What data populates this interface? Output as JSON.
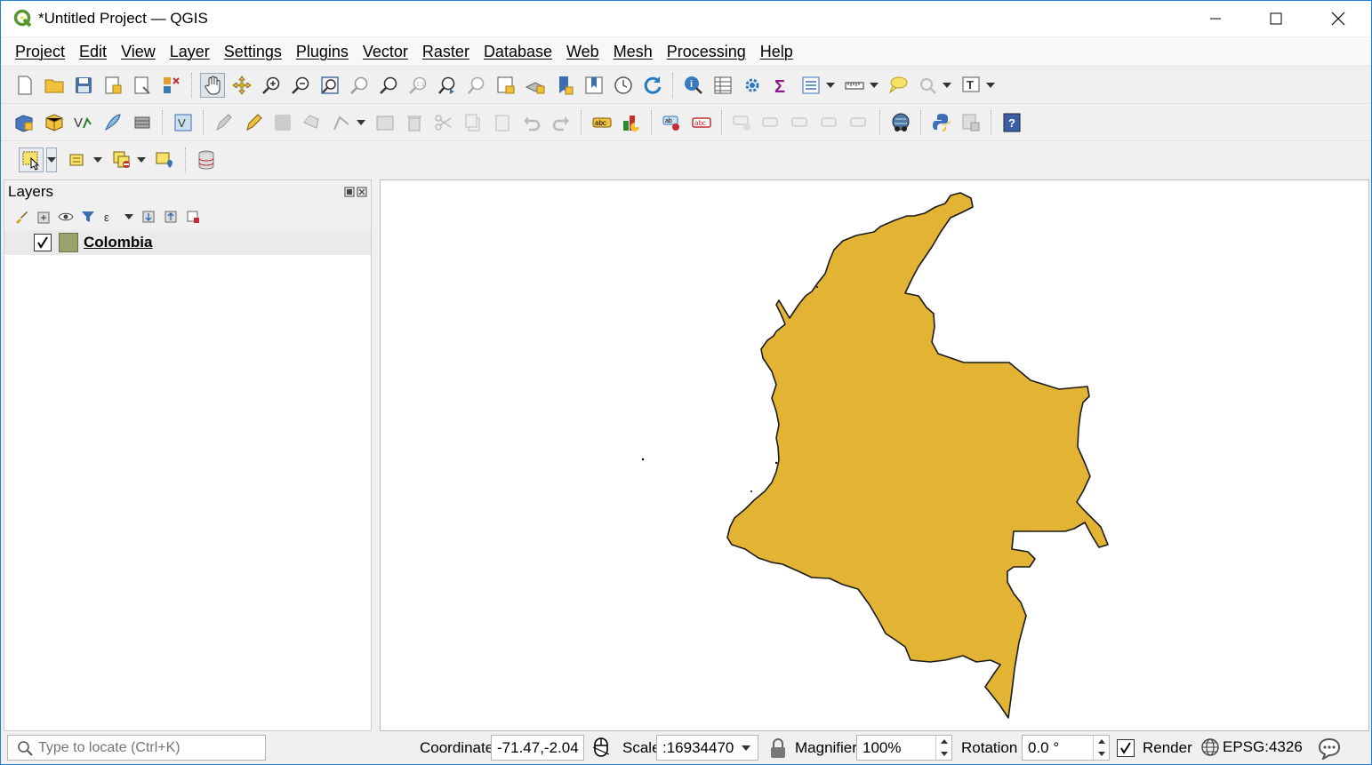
{
  "window": {
    "title": "*Untitled Project — QGIS"
  },
  "menu": [
    "Project",
    "Edit",
    "View",
    "Layer",
    "Settings",
    "Plugins",
    "Vector",
    "Raster",
    "Database",
    "Web",
    "Mesh",
    "Processing",
    "Help"
  ],
  "layers_panel": {
    "title": "Layers",
    "layers": [
      {
        "name": "Colombia",
        "visible": true,
        "color": "#9aa26b"
      }
    ]
  },
  "map": {
    "feature_fill": "#e3b433",
    "feature_stroke": "#1a1a1a"
  },
  "statusbar": {
    "locate_placeholder": "Type to locate (Ctrl+K)",
    "coordinate_label": "Coordinate",
    "coordinate_value": "-71.47,-2.04",
    "scale_label": "Scale",
    "scale_value": ":16934470",
    "magnifier_label": "Magnifier",
    "magnifier_value": "100%",
    "rotation_label": "Rotation",
    "rotation_value": "0.0 °",
    "render_label": "Render",
    "render_checked": true,
    "crs": "EPSG:4326"
  }
}
